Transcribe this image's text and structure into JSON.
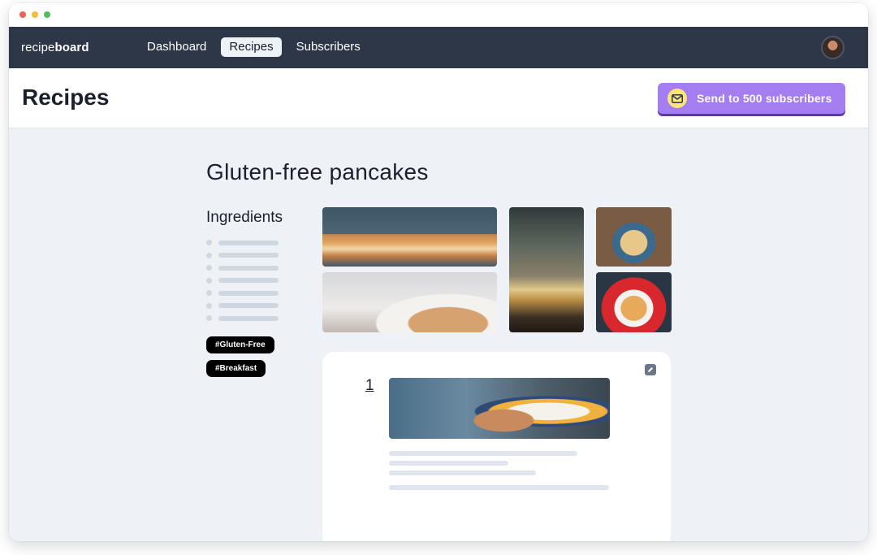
{
  "app": {
    "brand_light": "recipe",
    "brand_bold": "board"
  },
  "nav": {
    "items": [
      {
        "label": "Dashboard",
        "active": false
      },
      {
        "label": "Recipes",
        "active": true
      },
      {
        "label": "Subscribers",
        "active": false
      }
    ]
  },
  "header": {
    "title": "Recipes",
    "send_button_label": "Send to 500 subscribers",
    "send_icon": "envelope-icon"
  },
  "recipe": {
    "title": "Gluten-free pancakes",
    "ingredients_heading": "Ingredients",
    "tags": [
      "#Gluten-Free",
      "#Breakfast"
    ],
    "step": {
      "number": "1",
      "edit_icon": "pencil-icon"
    }
  },
  "colors": {
    "navbar": "#2d3748",
    "accent": "#a47df0",
    "background": "#eef2f6"
  }
}
